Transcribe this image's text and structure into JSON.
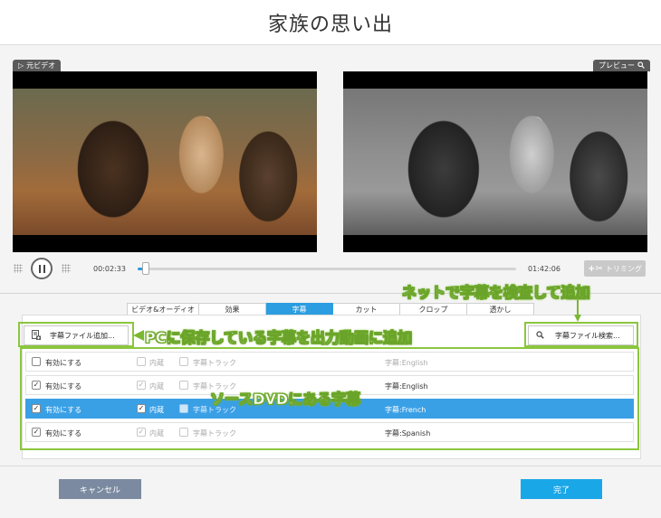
{
  "window": {
    "title": "家族の思い出"
  },
  "preview": {
    "source_label": "元ビデオ",
    "output_label": "プレビュー"
  },
  "player": {
    "current_time": "00:02:33",
    "total_time": "01:42:06",
    "progress_fraction": 0.02,
    "trim_label": "トリミング"
  },
  "tabs": [
    {
      "label": "ビデオ&オーディオ",
      "active": false
    },
    {
      "label": "効果",
      "active": false
    },
    {
      "label": "字幕",
      "active": true
    },
    {
      "label": "カット",
      "active": false
    },
    {
      "label": "クロップ",
      "active": false
    },
    {
      "label": "透かし",
      "active": false
    }
  ],
  "subtitle_panel": {
    "add_file_label": "字幕ファイル追加...",
    "search_file_label": "字幕ファイル検索...",
    "rows": [
      {
        "enable_label": "有効にする",
        "enabled": false,
        "builtin_label": "内蔵",
        "builtin": false,
        "track_label": "字幕トラック",
        "track": false,
        "subtitle": "字幕:English",
        "selected": false
      },
      {
        "enable_label": "有効にする",
        "enabled": true,
        "builtin_label": "内蔵",
        "builtin": true,
        "track_label": "字幕トラック",
        "track": false,
        "subtitle": "字幕:English",
        "selected": false
      },
      {
        "enable_label": "有効にする",
        "enabled": true,
        "builtin_label": "内蔵",
        "builtin": true,
        "track_label": "字幕トラック",
        "track": false,
        "subtitle": "字幕:French",
        "selected": true
      },
      {
        "enable_label": "有効にする",
        "enabled": true,
        "builtin_label": "内蔵",
        "builtin": true,
        "track_label": "字幕トラック",
        "track": false,
        "subtitle": "字幕:Spanish",
        "selected": false
      }
    ]
  },
  "annotations": {
    "net_search": "ネットで字幕を検査して追加",
    "pc_add": "PCに保存している字幕を出力動画に追加",
    "source_dvd": "ソースDVDにある字幕"
  },
  "footer": {
    "cancel_label": "キャンセル",
    "done_label": "完了"
  },
  "colors": {
    "accent": "#2b9de0",
    "annotation_green": "#8cc63f",
    "cancel_button": "#7b8aa0",
    "done_button": "#1aa7e8"
  }
}
